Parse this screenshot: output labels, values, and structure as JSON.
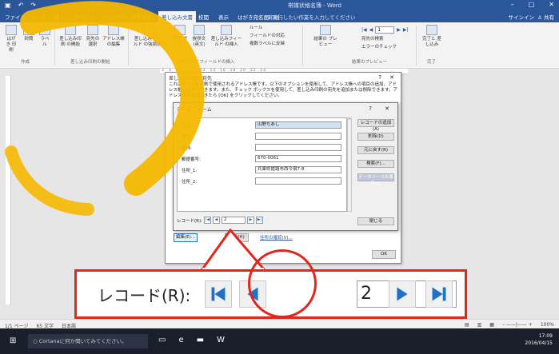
{
  "colors": {
    "word_blue": "#2b579a",
    "highlight_red": "#e1261c",
    "brush_yellow": "#f5b800"
  },
  "titlebar": {
    "title": "帯媒状格名簿 - Word"
  },
  "tabs": [
    {
      "label": "ファイル"
    },
    {
      "label": "ホーム"
    },
    {
      "label": "挿入"
    },
    {
      "label": "デザイン"
    },
    {
      "label": "レイアウト"
    },
    {
      "label": "参考資料"
    },
    {
      "label": "差し込み文書"
    },
    {
      "label": "校閲"
    },
    {
      "label": "表示"
    },
    {
      "label": "はがき宛名面印刷"
    }
  ],
  "tell_me": "実行したい作業を入力してください",
  "signin": "サインイン",
  "share": "共有",
  "ribbon": {
    "groups": {
      "create": "作成",
      "start": "差し込み印刷の開始",
      "fields": "文章入力とフィールドの挿入",
      "preview": "結果のプレビュー",
      "finish": "完了"
    },
    "buttons": [
      {
        "label": "はがき 印刷"
      },
      {
        "label": "封筒"
      },
      {
        "label": "ラベル"
      },
      {
        "label": "差し込み印刷 の開始"
      },
      {
        "label": "宛先の 選択"
      },
      {
        "label": "アドレス帳 の編集"
      },
      {
        "label": "差し込みフィールド の強調表示"
      },
      {
        "label": "住所 ブロック"
      },
      {
        "label": "挨拶文 (英文)"
      },
      {
        "label": "差し込みフィールド の挿入"
      },
      {
        "label": "結果の プレビュー"
      },
      {
        "label": "完了と 差し込み"
      }
    ],
    "small": {
      "rule": "ルール",
      "match": "フィールドの対応",
      "update": "複数ラベルに反映",
      "find": "宛先の検索",
      "check": "エラーのチェック"
    },
    "record_num": "1"
  },
  "outer_dialog": {
    "title": "差し込み印刷の宛先",
    "desc": "これは差し込み印刷で使用されるアドレス帳です。以下のオプションを使用して、アドレス帳への項目の追加、アドレス帳の変更ができます。また、チェック ボックスを使用して、差し込み印刷の宛先を追加または削除できます。アドレス帳が準備できたら [OK] をクリックしてください。",
    "edit": "編集(E)...",
    "update": "更新(H)",
    "verify": "住所の確認(V)...",
    "ok": "OK"
  },
  "data_form": {
    "title": "データ フォーム",
    "fields": [
      {
        "label": "氏名:",
        "value": "山野ちあし"
      },
      {
        "label": "連名:",
        "value": ""
      },
      {
        "label": "敬称:",
        "value": ""
      },
      {
        "label": "郵便番号:",
        "value": "670-0061"
      },
      {
        "label": "住所_1:",
        "value": "兵庫県姫路市西今宿7-8"
      },
      {
        "label": "住所_2:",
        "value": ""
      }
    ],
    "buttons": {
      "add": "レコードの追加(A)",
      "delete": "削除(D)",
      "restore": "元に戻す(R)",
      "find": "検索(F)...",
      "source": "データソースの表示(S)",
      "close": "閉じる"
    },
    "record_label": "レコード(R):",
    "record_value": "2"
  },
  "zoom": {
    "label": "レコード(R):",
    "value": "2"
  },
  "status": {
    "page": "1/1 ページ",
    "words": "65 文字",
    "lang": "日本語",
    "zoom": "100%"
  },
  "taskbar": {
    "cortana": "Cortanaに何か聞いてみてください。",
    "time": "17:09",
    "date": "2016/04/15"
  }
}
